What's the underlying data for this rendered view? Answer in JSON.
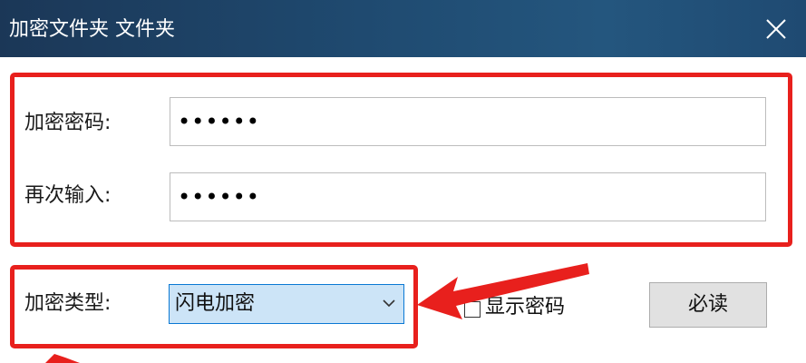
{
  "window": {
    "title": "加密文件夹 文件夹"
  },
  "form": {
    "password_label": "加密密码:",
    "password_value": "••••••",
    "confirm_label": "再次输入:",
    "confirm_value": "••••••",
    "type_label": "加密类型:",
    "type_selected": "闪电加密",
    "show_password_label": "显示密码",
    "show_password_checked": false,
    "read_button_label": "必读"
  },
  "icons": {
    "close": "close-icon",
    "dropdown": "chevron-down-icon"
  },
  "colors": {
    "titlebar": "#1f4a70",
    "annotation_red": "#e8201d",
    "select_bg": "#cce4f7",
    "select_border": "#0a78d4",
    "button_bg": "#e1e1e1"
  }
}
